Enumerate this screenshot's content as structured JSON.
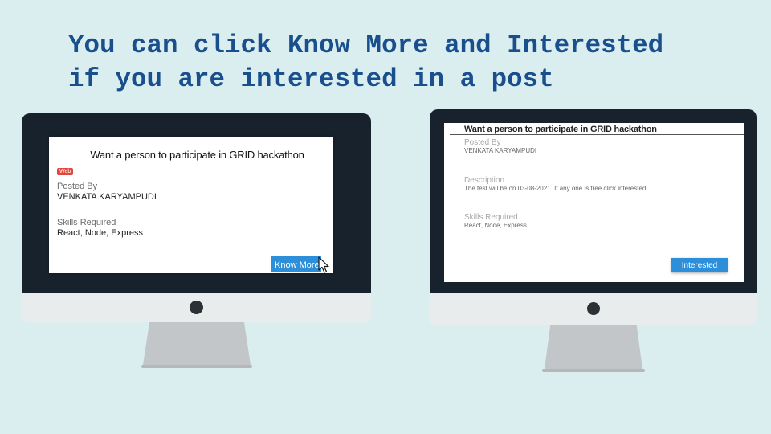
{
  "headline": {
    "line1": "You can click Know More and Interested",
    "line2": "if you are interested in a post"
  },
  "left_screen": {
    "post_title": "Want a person to participate in GRID hackathon",
    "badge": "Web",
    "posted_by_label": "Posted By",
    "posted_by_value": "VENKATA KARYAMPUDI",
    "skills_label": "Skills Required",
    "skills_value": "React, Node, Express",
    "know_more_button": "Know More",
    "cursor_icon": "arrow-cursor-icon"
  },
  "right_screen": {
    "post_title": "Want a person to participate in GRID hackathon",
    "posted_by_label": "Posted By",
    "posted_by_value": "VENKATA KARYAMPUDI",
    "description_label": "Description",
    "description_value": "The test will be on 03-08-2021. If any one is free click interested",
    "skills_label": "Skills Required",
    "skills_value": "React, Node, Express",
    "interested_button": "Interested"
  },
  "colors": {
    "background": "#daeef0",
    "headline": "#1a4f8e",
    "bezel": "#17222c",
    "button": "#2d8fd9",
    "badge": "#e5463c"
  }
}
